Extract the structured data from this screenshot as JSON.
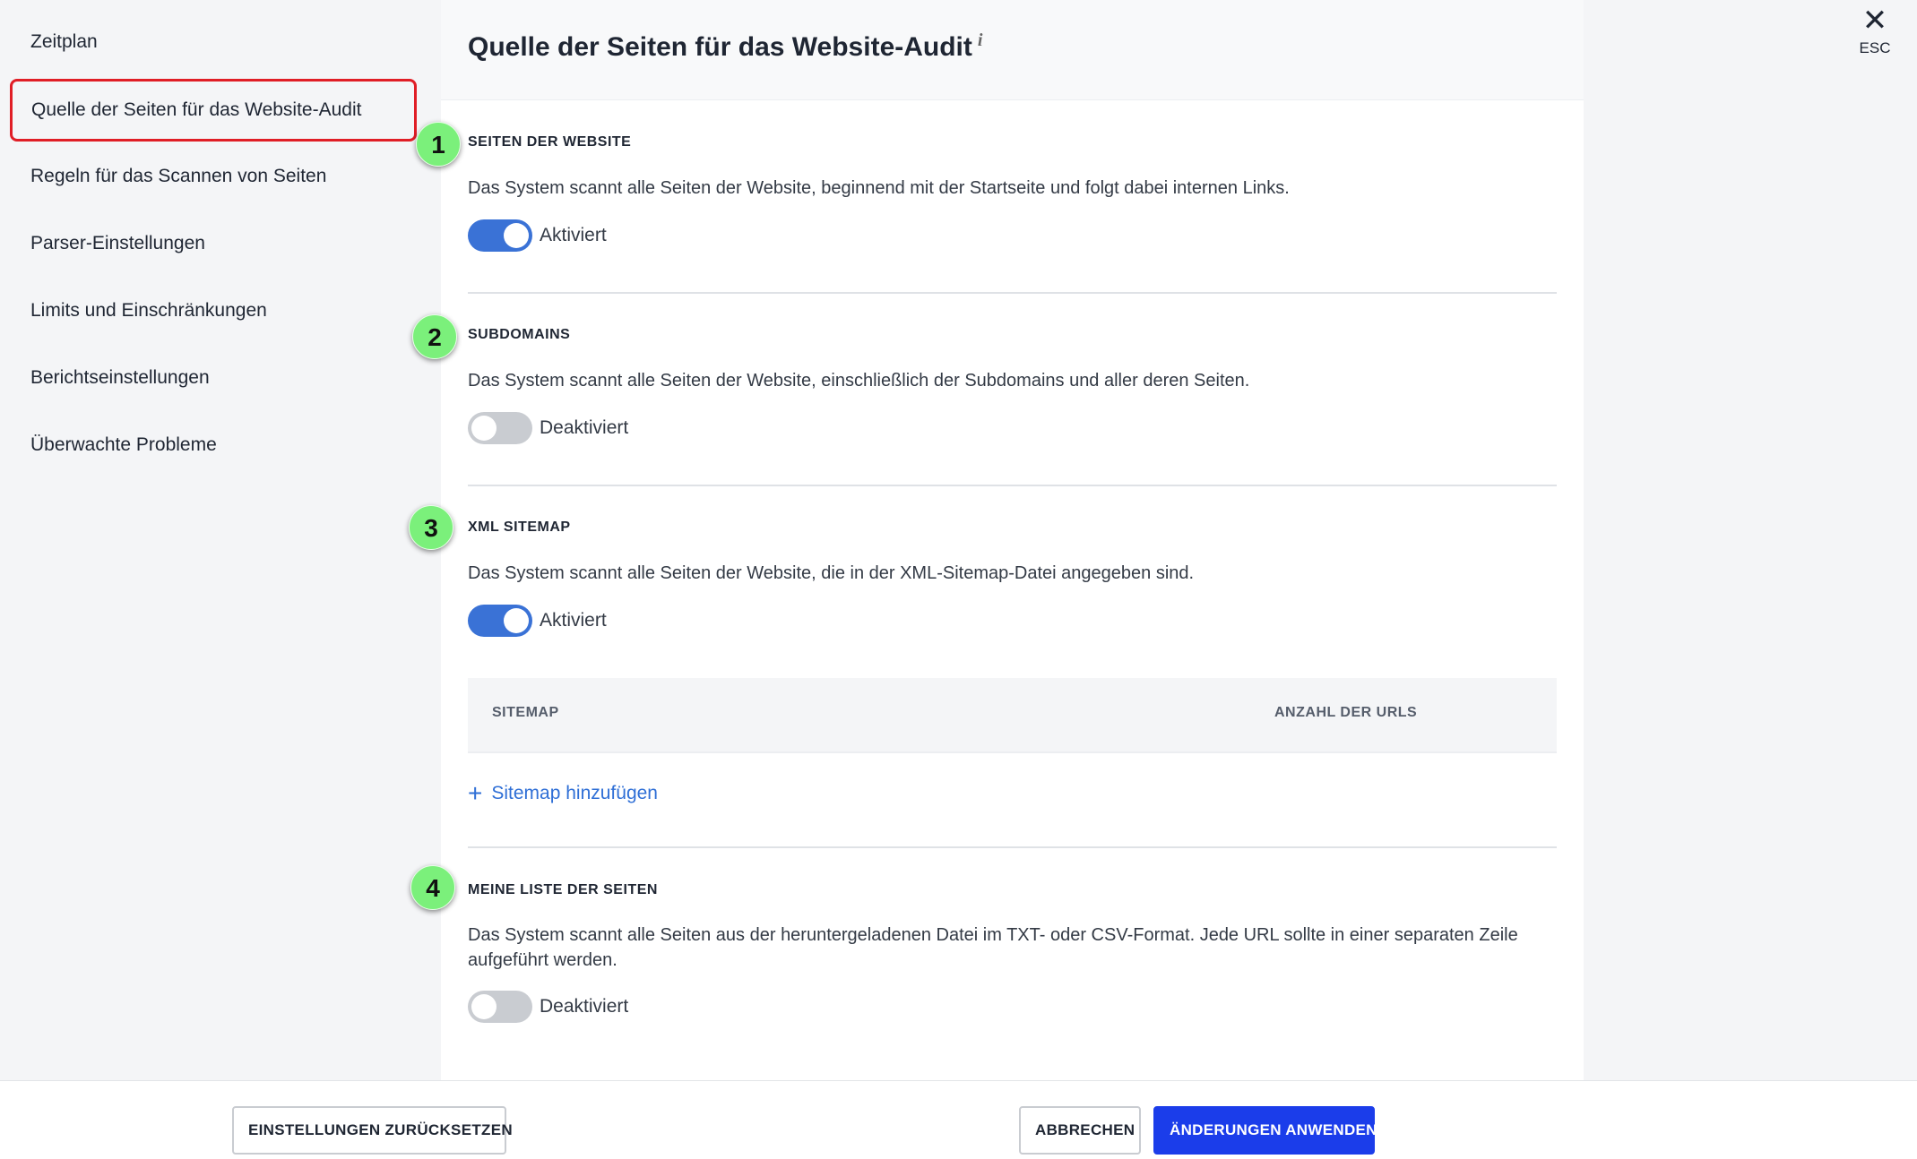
{
  "sidebar": {
    "items": [
      {
        "label": "Zeitplan"
      },
      {
        "label": "Quelle der Seiten für das Website-Audit"
      },
      {
        "label": "Regeln für das Scannen von Seiten"
      },
      {
        "label": "Parser-Einstellungen"
      },
      {
        "label": "Limits und Einschränkungen"
      },
      {
        "label": "Berichtseinstellungen"
      },
      {
        "label": "Überwachte Probleme"
      }
    ],
    "active_index": 1
  },
  "header": {
    "title": "Quelle der Seiten für das Website-Audit",
    "info": "i"
  },
  "sections": [
    {
      "badge": "1",
      "title": "SEITEN DER WEBSITE",
      "description": "Das System scannt alle Seiten der Website, beginnend mit der Startseite und folgt dabei internen Links.",
      "enabled": true,
      "status": "Aktiviert"
    },
    {
      "badge": "2",
      "title": "SUBDOMAINS",
      "description": "Das System scannt alle Seiten der Website, einschließlich der Subdomains und aller deren Seiten.",
      "enabled": false,
      "status": "Deaktiviert"
    },
    {
      "badge": "3",
      "title": "XML SITEMAP",
      "description": "Das System scannt alle Seiten der Website, die in der XML-Sitemap-Datei angegeben sind.",
      "enabled": true,
      "status": "Aktiviert"
    },
    {
      "badge": "4",
      "title": "MEINE LISTE DER SEITEN",
      "description": "Das System scannt alle Seiten aus der heruntergeladenen Datei im TXT- oder CSV-Format. Jede URL sollte in einer separaten Zeile aufgeführt werden.",
      "enabled": false,
      "status": "Deaktiviert"
    }
  ],
  "sitemap_table": {
    "columns": [
      "SITEMAP",
      "ANZAHL DER URLS"
    ],
    "add_label": "Sitemap hinzufügen"
  },
  "close": {
    "icon": "close-icon",
    "label": "ESC"
  },
  "footer": {
    "reset_label": "EINSTELLUNGEN ZURÜCKSETZEN",
    "cancel_label": "ABBRECHEN",
    "apply_label": "ÄNDERUNGEN ANWENDEN"
  },
  "colors": {
    "toggle_on": "#3a72d6",
    "toggle_off": "#c9ccd1",
    "primary_button": "#1b3dea",
    "active_outline": "#e01e26",
    "badge": "#7bf07b",
    "link": "#2f6fd6"
  }
}
